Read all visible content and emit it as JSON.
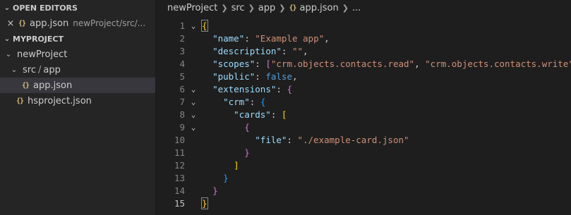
{
  "sidebar": {
    "open_editors": {
      "title": "OPEN EDITORS",
      "items": [
        {
          "name": "app.json",
          "description": "newProject/src/..."
        }
      ]
    },
    "project": {
      "title": "MYPROJECT",
      "tree": {
        "root": "newProject",
        "path_part1": "src",
        "path_sep": "/",
        "path_part2": "app",
        "file_app": "app.json",
        "file_hs": "hsproject.json"
      }
    }
  },
  "breadcrumb": {
    "items": [
      "newProject",
      "src",
      "app"
    ],
    "file": "app.json",
    "trailing": "..."
  },
  "icons": {
    "json_icon": "{}",
    "close": "close-icon",
    "chevron": "chevron-down-icon"
  },
  "colors": {
    "key": "#9cdcfe",
    "string": "#ce9178",
    "keyword": "#569cd6",
    "bracket_level1": "#ffd700",
    "bracket_level2": "#da70d6",
    "bracket_level3": "#179fff"
  },
  "editor": {
    "lines": [
      {
        "num": "1",
        "fold": true,
        "tokens": [
          [
            "b1 bm",
            "{"
          ]
        ]
      },
      {
        "num": "2",
        "fold": false,
        "tokens": [
          [
            "p",
            "  "
          ],
          [
            "k",
            "\"name\""
          ],
          [
            "p",
            ": "
          ],
          [
            "s",
            "\"Example app\""
          ],
          [
            "p",
            ","
          ]
        ]
      },
      {
        "num": "3",
        "fold": false,
        "tokens": [
          [
            "p",
            "  "
          ],
          [
            "k",
            "\"description\""
          ],
          [
            "p",
            ": "
          ],
          [
            "s",
            "\"\""
          ],
          [
            "p",
            ","
          ]
        ]
      },
      {
        "num": "4",
        "fold": false,
        "tokens": [
          [
            "p",
            "  "
          ],
          [
            "k",
            "\"scopes\""
          ],
          [
            "p",
            ": "
          ],
          [
            "b2",
            "["
          ],
          [
            "s",
            "\"crm.objects.contacts.read\""
          ],
          [
            "p",
            ", "
          ],
          [
            "s",
            "\"crm.objects.contacts.write\""
          ],
          [
            "b2",
            "]"
          ],
          [
            "p",
            ","
          ]
        ]
      },
      {
        "num": "5",
        "fold": false,
        "tokens": [
          [
            "p",
            "  "
          ],
          [
            "k",
            "\"public\""
          ],
          [
            "p",
            ": "
          ],
          [
            "kw",
            "false"
          ],
          [
            "p",
            ","
          ]
        ]
      },
      {
        "num": "6",
        "fold": true,
        "tokens": [
          [
            "p",
            "  "
          ],
          [
            "k",
            "\"extensions\""
          ],
          [
            "p",
            ": "
          ],
          [
            "b2",
            "{"
          ]
        ]
      },
      {
        "num": "7",
        "fold": true,
        "tokens": [
          [
            "p",
            "    "
          ],
          [
            "k",
            "\"crm\""
          ],
          [
            "p",
            ": "
          ],
          [
            "b3",
            "{"
          ]
        ]
      },
      {
        "num": "8",
        "fold": true,
        "tokens": [
          [
            "p",
            "      "
          ],
          [
            "k",
            "\"cards\""
          ],
          [
            "p",
            ": "
          ],
          [
            "b1",
            "["
          ]
        ]
      },
      {
        "num": "9",
        "fold": true,
        "tokens": [
          [
            "p",
            "        "
          ],
          [
            "b2",
            "{"
          ]
        ]
      },
      {
        "num": "10",
        "fold": false,
        "tokens": [
          [
            "p",
            "          "
          ],
          [
            "k",
            "\"file\""
          ],
          [
            "p",
            ": "
          ],
          [
            "s",
            "\"./example-card.json\""
          ]
        ]
      },
      {
        "num": "11",
        "fold": false,
        "tokens": [
          [
            "p",
            "        "
          ],
          [
            "b2",
            "}"
          ]
        ]
      },
      {
        "num": "12",
        "fold": false,
        "tokens": [
          [
            "p",
            "      "
          ],
          [
            "b1",
            "]"
          ]
        ]
      },
      {
        "num": "13",
        "fold": false,
        "tokens": [
          [
            "p",
            "    "
          ],
          [
            "b3",
            "}"
          ]
        ]
      },
      {
        "num": "14",
        "fold": false,
        "tokens": [
          [
            "p",
            "  "
          ],
          [
            "b2",
            "}"
          ]
        ]
      },
      {
        "num": "15",
        "fold": false,
        "current": true,
        "tokens": [
          [
            "b1 bm",
            "}"
          ]
        ]
      }
    ]
  }
}
